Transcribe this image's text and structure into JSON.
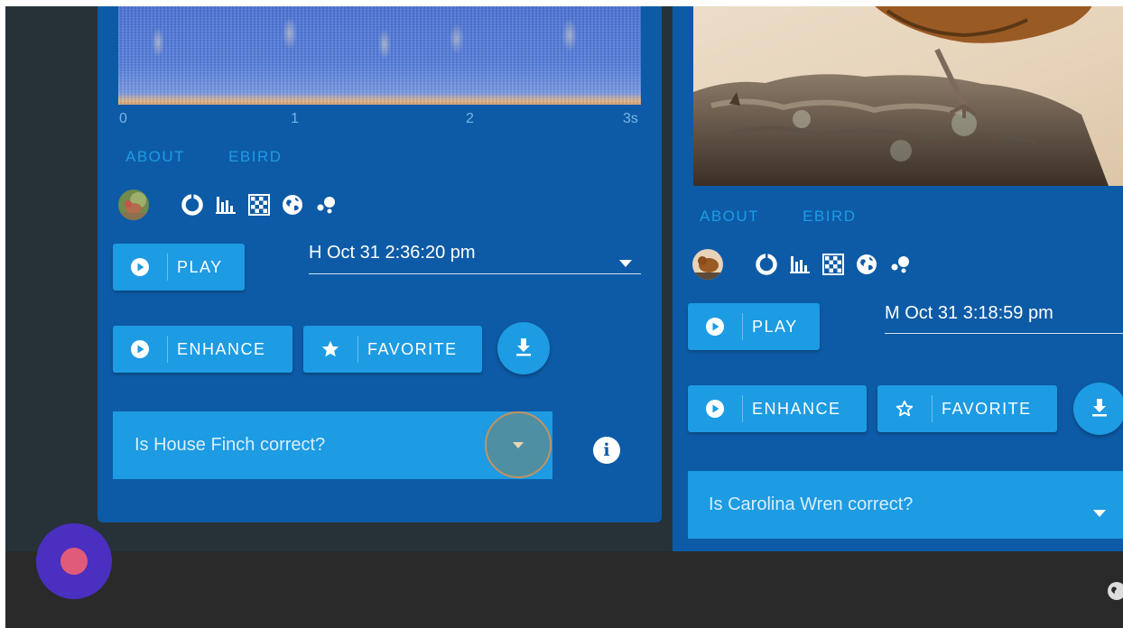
{
  "left_card": {
    "spectrogram_ticks": [
      "0",
      "1",
      "2",
      "3s"
    ],
    "tabs": [
      "ABOUT",
      "EBIRD"
    ],
    "icons": [
      "species-avatar-icon",
      "donut-chart-icon",
      "bar-chart-icon",
      "checkerboard-icon",
      "globe-icon",
      "scatter-icon"
    ],
    "play_label": "PLAY",
    "detection_select": "H Oct 31 2:36:20 pm",
    "enhance_label": "ENHANCE",
    "favorite_label": "FAVORITE",
    "question": "Is House Finch correct?",
    "info_glyph": "i"
  },
  "right_card": {
    "tabs": [
      "ABOUT",
      "EBIRD"
    ],
    "play_label": "PLAY",
    "detection_select": "M Oct 31 3:18:59 pm",
    "enhance_label": "ENHANCE",
    "favorite_label": "FAVORITE",
    "question": "Is Carolina Wren correct?"
  },
  "colors": {
    "card": "#0d5ba6",
    "button": "#1d9be3",
    "link": "#1e9be8",
    "page_bg": "#263238",
    "record_fab": "#4a2fc0"
  }
}
